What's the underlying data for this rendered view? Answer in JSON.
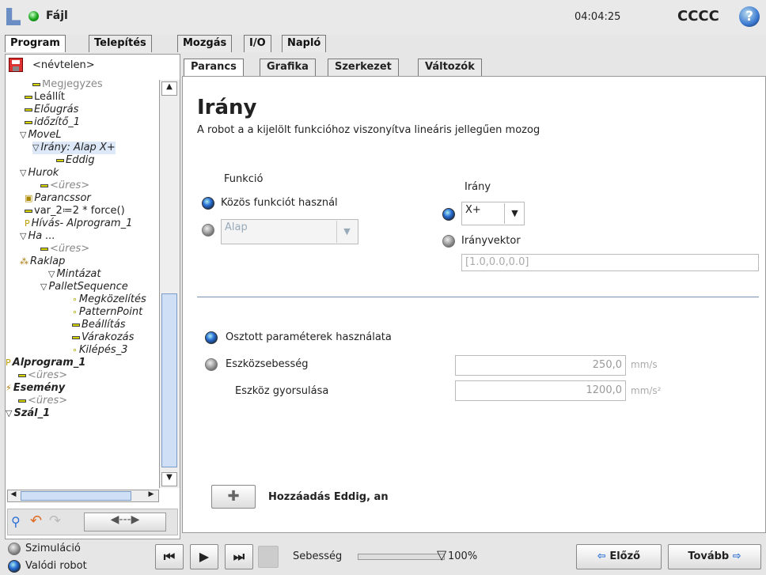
{
  "header": {
    "menu": "Fájl",
    "clock": "04:04:25",
    "robot_name": "CCCC"
  },
  "main_tabs": [
    "Program",
    "Telepítés",
    "Mozgás",
    "I/O",
    "Napló"
  ],
  "left": {
    "program_name": "<névtelen>"
  },
  "tree": [
    {
      "label": "Megjegyzés",
      "italic": false
    },
    {
      "label": "Leállít",
      "italic": false
    },
    {
      "label": "Előugrás",
      "italic": true
    },
    {
      "label": "időzítő_1",
      "italic": true
    },
    {
      "label": "MoveL",
      "italic": true
    },
    {
      "label": "Irány: Alap X+",
      "italic": true
    },
    {
      "label": "Eddig",
      "italic": true
    },
    {
      "label": "Hurok",
      "italic": true
    },
    {
      "label": "<üres>",
      "italic": true
    },
    {
      "label": "Parancssor",
      "italic": true
    },
    {
      "label": "var_2≔2 * force()",
      "italic": false
    },
    {
      "label": "Hívás- Alprogram_1",
      "italic": true
    },
    {
      "label": "Ha ...",
      "italic": true
    },
    {
      "label": "<üres>",
      "italic": true
    },
    {
      "label": "Raklap",
      "italic": true
    },
    {
      "label": "Mintázat",
      "italic": true
    },
    {
      "label": "PalletSequence",
      "italic": true
    },
    {
      "label": "Megközelítés",
      "italic": true
    },
    {
      "label": "PatternPoint",
      "italic": true
    },
    {
      "label": "Beállítás",
      "italic": true
    },
    {
      "label": "Várakozás",
      "italic": true
    },
    {
      "label": "Kilépés_3",
      "italic": true
    },
    {
      "label": "Alprogram_1",
      "italic": true
    },
    {
      "label": "<üres>",
      "italic": true
    },
    {
      "label": "Esemény",
      "italic": true
    },
    {
      "label": "<üres>",
      "italic": true
    },
    {
      "label": "Szál_1",
      "italic": true
    }
  ],
  "sub_tabs": [
    "Parancs",
    "Grafika",
    "Szerkezet",
    "Változók"
  ],
  "panel": {
    "title": "Irány",
    "subtitle": "A robot a a kijelölt funkcióhoz viszonyítva lineáris jellegűen mozog",
    "funkcio_label": "Funkció",
    "common_feature": "Közös funkciót használ",
    "feature_value": "Alap",
    "irany_label": "Irány",
    "direction_value": "X+",
    "vector_label": "Irányvektor",
    "vector_value": "[1.0,0.0,0.0]",
    "shared_params": "Osztott paraméterek használata",
    "tool_speed_label": "Eszközsebesség",
    "tool_speed_value": "250,0",
    "tool_speed_unit": "mm/s",
    "tool_accel_label": "Eszköz gyorsulása",
    "tool_accel_value": "1200,0",
    "tool_accel_unit": "mm/s²",
    "add_button": "Hozzáadás Eddig, an"
  },
  "bottom": {
    "simulation": "Szimuláció",
    "real_robot": "Valódi robot",
    "speed_label": "Sebesség",
    "speed_value": "100%",
    "speed_fraction": 1.0,
    "prev": "Előző",
    "next": "Tovább"
  }
}
